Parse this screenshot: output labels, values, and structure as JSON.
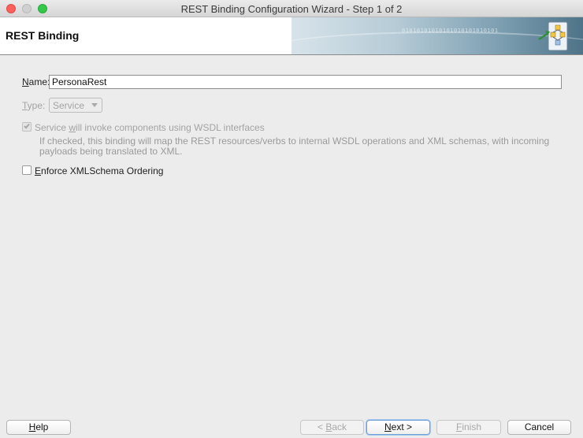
{
  "window": {
    "title": "REST Binding Configuration Wizard - Step 1 of 2"
  },
  "header": {
    "title": "REST Binding",
    "decor_bits": "01010101010101010101010101"
  },
  "form": {
    "name_label_mnemonic": "N",
    "name_label_rest": "ame:",
    "name_value": "PersonaRest",
    "type_label_mnemonic": "T",
    "type_label_rest": "ype:",
    "type_value": "Service",
    "wsdl_checkbox": {
      "label_pre": "Service ",
      "label_mnemonic": "w",
      "label_post": "ill invoke components using WSDL interfaces",
      "checked": true,
      "enabled": false
    },
    "wsdl_help": "If checked, this binding will map the REST resources/verbs to internal WSDL operations and XML schemas, with incoming payloads being translated to XML.",
    "ordering_checkbox": {
      "label_mnemonic": "E",
      "label_rest": "nforce XMLSchema Ordering",
      "checked": false
    }
  },
  "buttons": {
    "help_mnemonic": "H",
    "help_rest": "elp",
    "back_pre": "< ",
    "back_mnemonic": "B",
    "back_rest": "ack",
    "next_mnemonic": "N",
    "next_rest": "ext >",
    "finish_mnemonic": "F",
    "finish_rest": "inish",
    "cancel_label": "Cancel"
  },
  "colors": {
    "accent_focus": "#6d9fd6",
    "close": "#fc605c",
    "maximize": "#34c84a"
  }
}
